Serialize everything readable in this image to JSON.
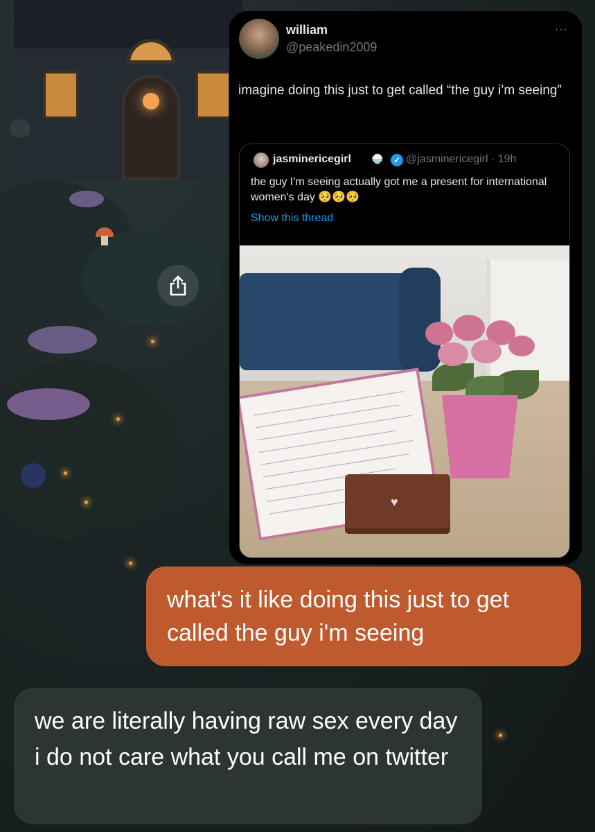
{
  "tweet": {
    "author_name": "william",
    "author_handle": "@peakedin2009",
    "text": "imagine doing this just to get called “the guy i’m seeing”",
    "more_glyph": "···",
    "quoted": {
      "author_name": "jasminericegirl",
      "author_emoji": "🍚",
      "handle_time": "@jasminericegirl · 19h",
      "text": "the guy I'm seeing actually got me a present for international women's day",
      "emojis": "🥺🥺🥺",
      "show_thread": "Show this thread"
    }
  },
  "messages": [
    {
      "direction": "outgoing",
      "text": "what's it like doing this just to get called the guy i'm seeing"
    },
    {
      "direction": "incoming",
      "text": "we are literally having raw sex every day i do not care what you call me on twitter"
    }
  ],
  "icons": {
    "share": "share-icon",
    "verified": "verified-badge-icon"
  },
  "colors": {
    "outgoing_bubble": "#bf5a2e",
    "incoming_bubble": "#2c3434",
    "tweet_background": "#000000",
    "link_blue": "#1d9bf0"
  }
}
